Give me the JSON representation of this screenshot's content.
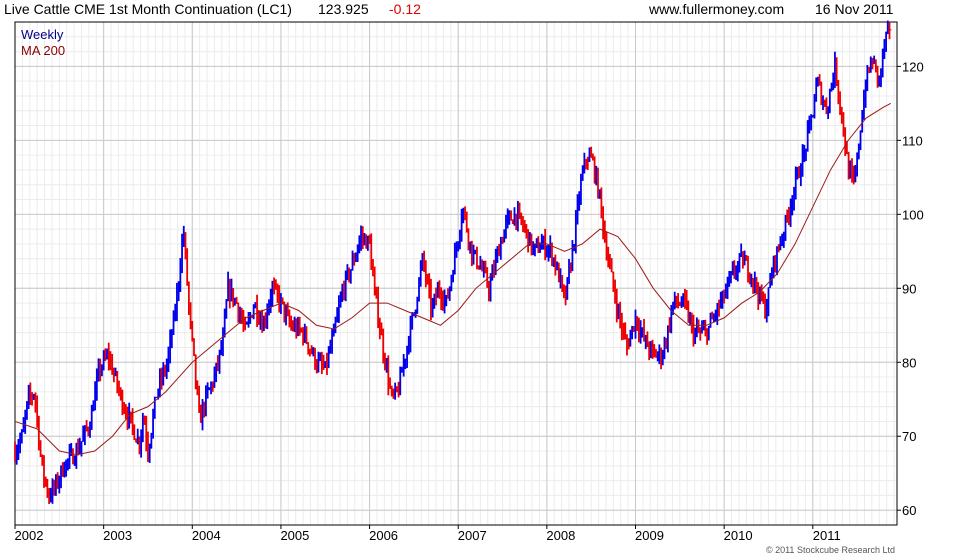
{
  "header": {
    "instrument": "Live Cattle CME 1st Month Continuation (LC1)",
    "last": "123.925",
    "change": "-0.12",
    "site": "www.fullermoney.com",
    "date": "16 Nov 2011"
  },
  "legend": {
    "period": "Weekly",
    "ma": "MA 200"
  },
  "copyright": "© 2011 Stockcube Research Ltd",
  "colors": {
    "up": "#0000ee",
    "down": "#ee0000",
    "ma": "#9b1b1b",
    "grid": "#c8c8c8",
    "frame": "#000000",
    "legend_period": "#00008b",
    "legend_ma": "#8b0000"
  },
  "chart_data": {
    "type": "line",
    "title": "Live Cattle CME 1st Month Continuation (LC1)",
    "xlabel": "",
    "ylabel": "",
    "x_ticks": [
      "2002",
      "2003",
      "2004",
      "2005",
      "2006",
      "2007",
      "2008",
      "2009",
      "2010",
      "2011"
    ],
    "y_ticks": [
      60,
      70,
      80,
      90,
      100,
      110,
      120
    ],
    "xlim": [
      2002.0,
      2011.95
    ],
    "ylim": [
      58,
      126
    ],
    "y_axis": "right",
    "grid": true,
    "legend_position": "top-left",
    "series": [
      {
        "name": "Weekly",
        "style": "price bars (blue = up week, red = down week)",
        "points": [
          [
            2002.0,
            68
          ],
          [
            2002.08,
            70
          ],
          [
            2002.15,
            75
          ],
          [
            2002.22,
            76
          ],
          [
            2002.3,
            66
          ],
          [
            2002.38,
            62
          ],
          [
            2002.45,
            63
          ],
          [
            2002.55,
            66
          ],
          [
            2002.7,
            68
          ],
          [
            2002.85,
            72
          ],
          [
            2002.95,
            79
          ],
          [
            2003.05,
            81
          ],
          [
            2003.2,
            75
          ],
          [
            2003.3,
            72
          ],
          [
            2003.4,
            69
          ],
          [
            2003.45,
            73
          ],
          [
            2003.5,
            68
          ],
          [
            2003.6,
            76
          ],
          [
            2003.72,
            80
          ],
          [
            2003.82,
            88
          ],
          [
            2003.9,
            98
          ],
          [
            2003.97,
            86
          ],
          [
            2004.02,
            80
          ],
          [
            2004.08,
            72
          ],
          [
            2004.15,
            75
          ],
          [
            2004.25,
            78
          ],
          [
            2004.35,
            83
          ],
          [
            2004.4,
            90
          ],
          [
            2004.5,
            88
          ],
          [
            2004.6,
            84
          ],
          [
            2004.7,
            88
          ],
          [
            2004.8,
            85
          ],
          [
            2004.9,
            90
          ],
          [
            2005.0,
            88
          ],
          [
            2005.1,
            85
          ],
          [
            2005.25,
            84
          ],
          [
            2005.4,
            80
          ],
          [
            2005.5,
            79
          ],
          [
            2005.6,
            84
          ],
          [
            2005.7,
            90
          ],
          [
            2005.8,
            93
          ],
          [
            2005.9,
            97
          ],
          [
            2006.0,
            96
          ],
          [
            2006.05,
            90
          ],
          [
            2006.15,
            82
          ],
          [
            2006.25,
            75
          ],
          [
            2006.32,
            76
          ],
          [
            2006.42,
            82
          ],
          [
            2006.52,
            88
          ],
          [
            2006.6,
            94
          ],
          [
            2006.7,
            87
          ],
          [
            2006.78,
            90
          ],
          [
            2006.87,
            88
          ],
          [
            2007.0,
            97
          ],
          [
            2007.05,
            101
          ],
          [
            2007.15,
            95
          ],
          [
            2007.25,
            93
          ],
          [
            2007.35,
            90
          ],
          [
            2007.45,
            95
          ],
          [
            2007.55,
            99
          ],
          [
            2007.65,
            100
          ],
          [
            2007.75,
            98
          ],
          [
            2007.85,
            95
          ],
          [
            2007.95,
            96
          ],
          [
            2008.05,
            95
          ],
          [
            2008.15,
            91
          ],
          [
            2008.2,
            88
          ],
          [
            2008.3,
            96
          ],
          [
            2008.38,
            104
          ],
          [
            2008.45,
            108
          ],
          [
            2008.52,
            107
          ],
          [
            2008.6,
            102
          ],
          [
            2008.65,
            97
          ],
          [
            2008.72,
            92
          ],
          [
            2008.8,
            87
          ],
          [
            2008.9,
            82
          ],
          [
            2009.0,
            86
          ],
          [
            2009.1,
            83
          ],
          [
            2009.2,
            81
          ],
          [
            2009.3,
            81
          ],
          [
            2009.38,
            85
          ],
          [
            2009.42,
            88
          ],
          [
            2009.55,
            88
          ],
          [
            2009.65,
            84
          ],
          [
            2009.8,
            84
          ],
          [
            2010.0,
            89
          ],
          [
            2010.1,
            92
          ],
          [
            2010.2,
            94
          ],
          [
            2010.3,
            92
          ],
          [
            2010.4,
            89
          ],
          [
            2010.47,
            87
          ],
          [
            2010.55,
            93
          ],
          [
            2010.6,
            95
          ],
          [
            2010.7,
            99
          ],
          [
            2010.8,
            104
          ],
          [
            2010.9,
            108
          ],
          [
            2011.0,
            114
          ],
          [
            2011.05,
            118
          ],
          [
            2011.15,
            114
          ],
          [
            2011.25,
            120
          ],
          [
            2011.32,
            114
          ],
          [
            2011.4,
            106
          ],
          [
            2011.47,
            104
          ],
          [
            2011.55,
            113
          ],
          [
            2011.6,
            118
          ],
          [
            2011.67,
            121
          ],
          [
            2011.75,
            118
          ],
          [
            2011.82,
            124
          ],
          [
            2011.88,
            123.9
          ]
        ]
      },
      {
        "name": "MA 200",
        "points": [
          [
            2002.0,
            72
          ],
          [
            2002.25,
            71
          ],
          [
            2002.5,
            68
          ],
          [
            2002.7,
            67.5
          ],
          [
            2002.9,
            68
          ],
          [
            2003.1,
            70
          ],
          [
            2003.3,
            73
          ],
          [
            2003.5,
            74
          ],
          [
            2003.7,
            76
          ],
          [
            2003.85,
            78
          ],
          [
            2004.0,
            80
          ],
          [
            2004.2,
            82
          ],
          [
            2004.4,
            84
          ],
          [
            2004.6,
            86
          ],
          [
            2004.8,
            87
          ],
          [
            2005.0,
            88
          ],
          [
            2005.2,
            87
          ],
          [
            2005.4,
            85
          ],
          [
            2005.6,
            84.5
          ],
          [
            2005.8,
            86
          ],
          [
            2006.0,
            88
          ],
          [
            2006.2,
            88
          ],
          [
            2006.4,
            87
          ],
          [
            2006.6,
            86
          ],
          [
            2006.8,
            85
          ],
          [
            2007.0,
            87
          ],
          [
            2007.2,
            90
          ],
          [
            2007.4,
            92
          ],
          [
            2007.6,
            94
          ],
          [
            2007.8,
            96
          ],
          [
            2008.0,
            96
          ],
          [
            2008.2,
            95
          ],
          [
            2008.4,
            96
          ],
          [
            2008.6,
            98
          ],
          [
            2008.8,
            97
          ],
          [
            2009.0,
            94
          ],
          [
            2009.2,
            90
          ],
          [
            2009.4,
            87
          ],
          [
            2009.6,
            85
          ],
          [
            2009.8,
            85
          ],
          [
            2010.0,
            86
          ],
          [
            2010.2,
            88
          ],
          [
            2010.4,
            89.5
          ],
          [
            2010.6,
            92
          ],
          [
            2010.8,
            96
          ],
          [
            2011.0,
            101
          ],
          [
            2011.2,
            106
          ],
          [
            2011.4,
            110
          ],
          [
            2011.6,
            113
          ],
          [
            2011.8,
            114.5
          ],
          [
            2011.88,
            115
          ]
        ]
      }
    ]
  }
}
